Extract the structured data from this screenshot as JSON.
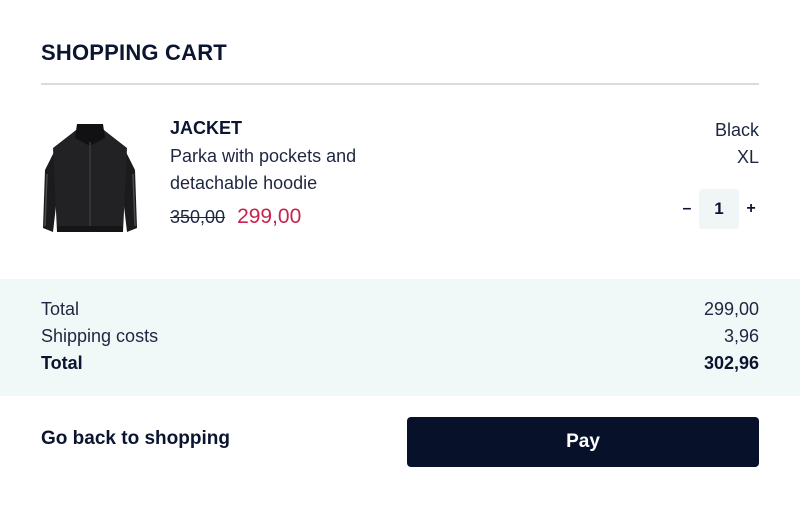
{
  "cart": {
    "title": "SHOPPING CART"
  },
  "item": {
    "name": "JACKET",
    "description_line1": "Parka with pockets and",
    "description_line2": "detachable hoodie",
    "old_price": "350,00",
    "new_price": "299,00",
    "color": "Black",
    "size": "XL",
    "quantity": "1",
    "decrease_label": "–",
    "increase_label": "+",
    "image_icon": "black-jacket"
  },
  "summary": {
    "subtotal_label": "Total",
    "subtotal_value": "299,00",
    "shipping_label": "Shipping costs",
    "shipping_value": "3,96",
    "total_label": "Total",
    "total_value": "302,96"
  },
  "footer": {
    "back_label": "Go back to shopping",
    "pay_label": "Pay"
  },
  "colors": {
    "primary": "#07122a",
    "sale_price": "#c8234d",
    "summary_background": "#f1f8f8"
  }
}
